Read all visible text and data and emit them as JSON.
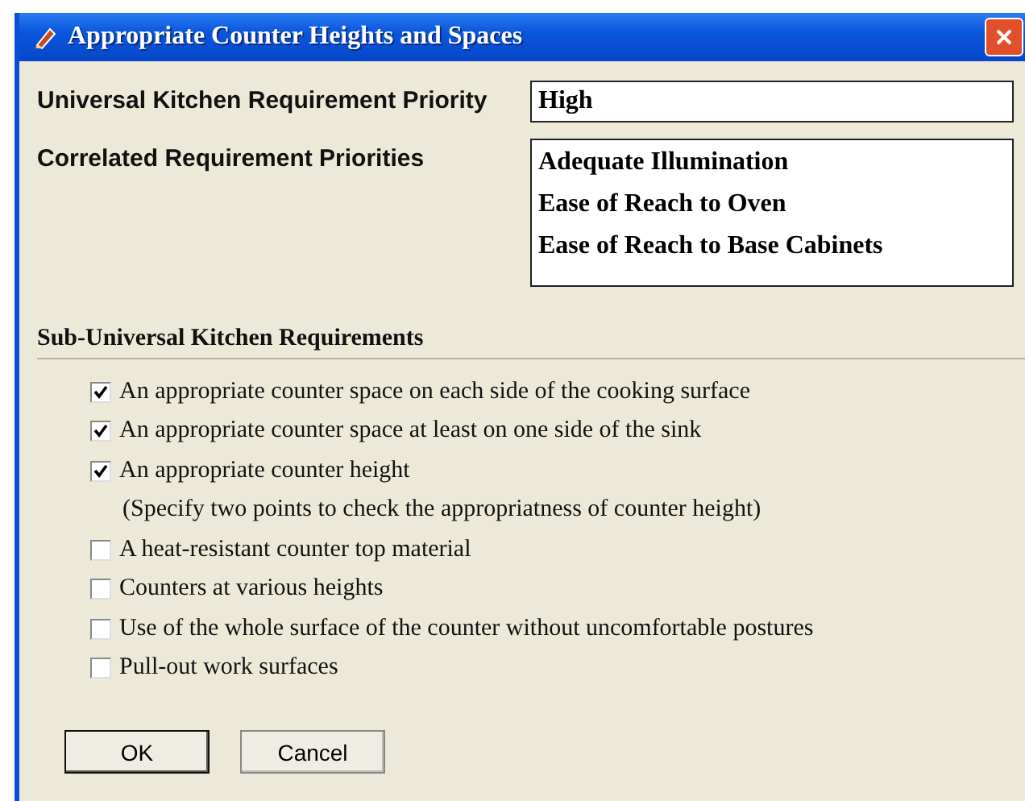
{
  "window": {
    "title": "Appropriate Counter Heights and Spaces"
  },
  "priority": {
    "label": "Universal Kitchen Requirement Priority",
    "value": "High"
  },
  "correlated": {
    "label": "Correlated Requirement Priorities",
    "items": [
      "Adequate Illumination",
      "Ease of Reach to Oven",
      "Ease of Reach to Base Cabinets"
    ]
  },
  "section": {
    "title": "Sub-Universal Kitchen Requirements"
  },
  "requirements": [
    {
      "kind": "checkbox",
      "label": "An appropriate counter space on each side of the cooking surface",
      "checked": true
    },
    {
      "kind": "checkbox",
      "label": "An appropriate counter space at least on one side of the sink",
      "checked": true
    },
    {
      "kind": "checkbox",
      "label": "An appropriate counter height",
      "checked": true
    },
    {
      "kind": "note",
      "label": "(Specify two points to check the appropriatness of counter height)"
    },
    {
      "kind": "checkbox",
      "label": "A heat-resistant counter top material",
      "checked": false
    },
    {
      "kind": "checkbox",
      "label": "Counters at various heights",
      "checked": false
    },
    {
      "kind": "checkbox",
      "label": "Use of the whole surface of the counter without uncomfortable postures",
      "checked": false
    },
    {
      "kind": "checkbox",
      "label": "Pull-out work surfaces",
      "checked": false
    }
  ],
  "buttons": [
    {
      "label": "OK",
      "default": true
    },
    {
      "label": "Cancel",
      "default": false
    }
  ]
}
